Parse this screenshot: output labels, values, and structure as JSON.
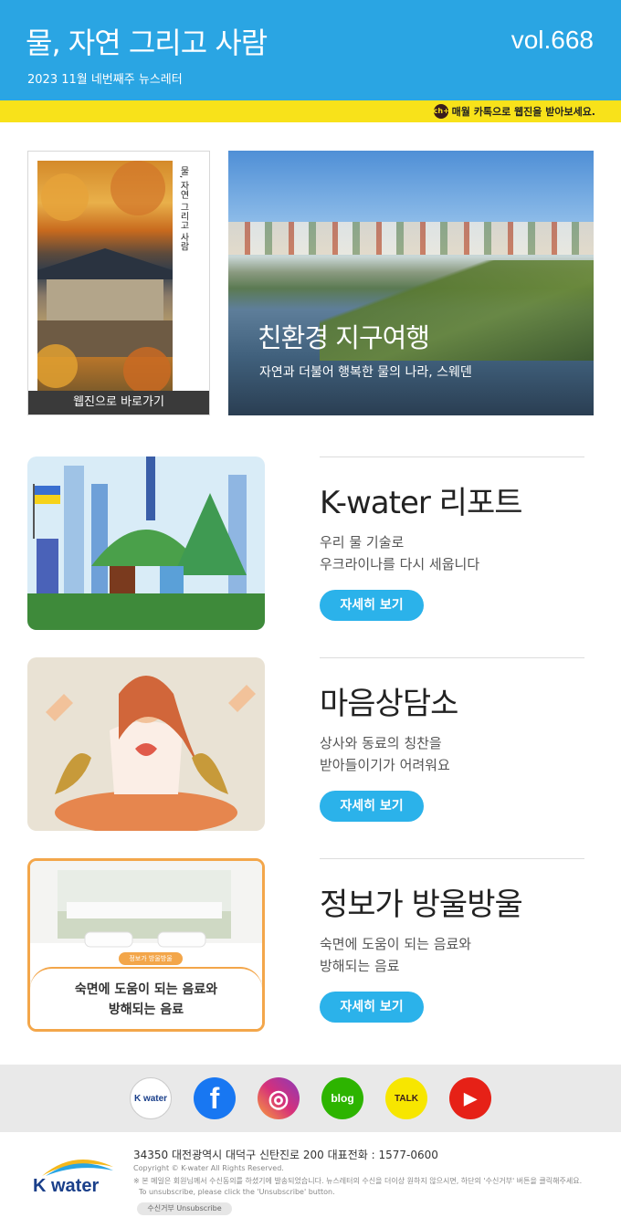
{
  "header": {
    "title": "물, 자연 그리고 사람",
    "subtitle": "2023 11월 네번째주 뉴스레터",
    "volume": "vol.668",
    "kakao_text": "매월 카톡으로 웹진을 받아보세요.",
    "kakao_badge": "ch+"
  },
  "webzine": {
    "button_label": "웹진으로 바로가기",
    "cover_title": "물, 자연 그리고 사람"
  },
  "hero": {
    "title": "친환경 지구여행",
    "description": "자연과 더불어 행복한 물의 나라, 스웨덴"
  },
  "articles": [
    {
      "title": "K-water 리포트",
      "desc1": "우리 물 기술로",
      "desc2": "우크라이나를 다시 세웁니다",
      "button": "자세히 보기"
    },
    {
      "title": "마음상담소",
      "desc1": "상사와 동료의 칭찬을",
      "desc2": "받아들이기가 어려워요",
      "button": "자세히 보기"
    },
    {
      "title": "정보가 방울방울",
      "desc1": "숙면에 도움이 되는 음료와",
      "desc2": "방해되는 음료",
      "button": "자세히 보기"
    }
  ],
  "article3_image": {
    "badge": "정보가 방울방울",
    "line1": "숙면에 도움이 되는 음료와",
    "line2": "방해되는 음료"
  },
  "social": [
    {
      "name": "kwater",
      "label": "K water",
      "color": "#ffffff"
    },
    {
      "name": "facebook",
      "label": "f",
      "color": "#1877f2"
    },
    {
      "name": "instagram",
      "label": "◎",
      "color": "#d6307a"
    },
    {
      "name": "blog",
      "label": "blog",
      "color": "#2db400"
    },
    {
      "name": "kakaotalk",
      "label": "TALK",
      "color": "#f7e600"
    },
    {
      "name": "youtube",
      "label": "▶",
      "color": "#e62117"
    }
  ],
  "footer": {
    "logo": "K water",
    "address": "34350 대전광역시 대덕구 신탄진로 200  대표전화 : 1577-0600",
    "copyright": "Copyright © K-water All Rights Reserved.",
    "note1": "※ 본 메일은 회원님께서 수신동의를 하셨기에 발송되었습니다. 뉴스레터의 수신을 더이상 원하지 않으시면, 하단의 '수신거부' 버튼을 클릭해주세요.",
    "note2": "To unsubscribe, please click the 'Unsubscribe' button.",
    "unsubscribe": "수신거부  Unsubscribe"
  }
}
